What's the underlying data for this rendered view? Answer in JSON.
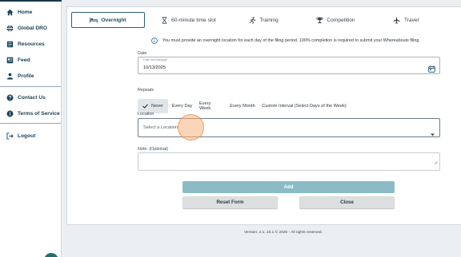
{
  "sidebar": {
    "items": [
      {
        "label": "Home",
        "icon": "home-icon"
      },
      {
        "label": "Global DRO",
        "icon": "globe-icon"
      },
      {
        "label": "Resources",
        "icon": "document-icon"
      },
      {
        "label": "Feed",
        "icon": "feed-icon"
      },
      {
        "label": "Profile",
        "icon": "person-icon"
      },
      {
        "label": "Contact Us",
        "icon": "help-icon"
      },
      {
        "label": "Terms of Service",
        "icon": "info-icon"
      },
      {
        "label": "Logout",
        "icon": "logout-icon"
      }
    ]
  },
  "tabs": [
    {
      "label": "Overnight",
      "icon": "bed-icon",
      "active": true
    },
    {
      "label": "60-minute time slot",
      "icon": "hourglass-icon"
    },
    {
      "label": "Training",
      "icon": "running-icon"
    },
    {
      "label": "Competition",
      "icon": "trophy-icon"
    },
    {
      "label": "Travel",
      "icon": "plane-icon"
    }
  ],
  "info_message": "You must provide an overnight location for each day of the filing period. 100% completion is required to submit your Whereabouts filing.",
  "form": {
    "date_label": "Date",
    "date_float": "Date mm/dd/yyyy*",
    "date_value": "10/13/2025",
    "repeats_label": "Repeats",
    "repeat_options": [
      "Never",
      "Every Day",
      "Every Week",
      "Every Month",
      "Custom Interval (Select Days of the Week)"
    ],
    "repeat_selected": "Never",
    "location_label": "Location",
    "location_placeholder": "Select a Location",
    "note_label": "Note: (Optional)"
  },
  "buttons": {
    "add": "Add",
    "reset": "Reset Form",
    "close": "Close"
  },
  "footer": "Version: 2.1..10.1 © 2025 - All rights reserved.",
  "colors": {
    "primary": "#1e4a62",
    "add_button": "#8bbcc6",
    "sidebar_text": "#1c4258"
  }
}
